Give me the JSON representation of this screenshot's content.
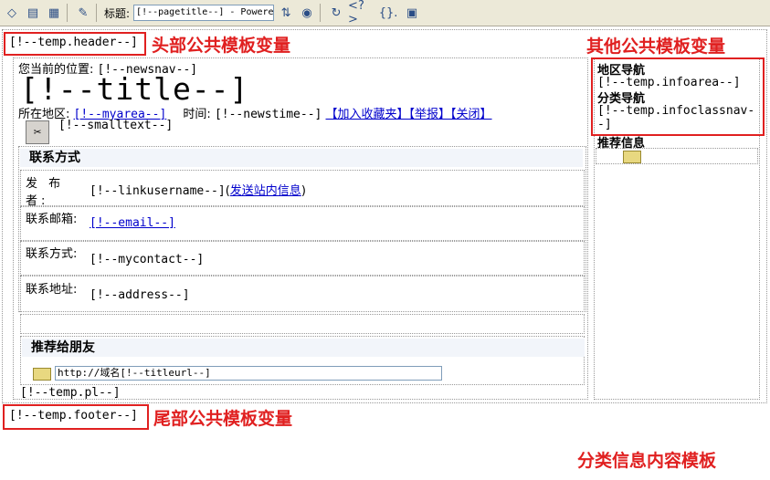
{
  "toolbar": {
    "title_label": "标题:",
    "title_value": "[!--pagetitle--] - Powere"
  },
  "labels": {
    "header_var": "头部公共模板变量",
    "other_var": "其他公共模板变量",
    "footer_var": "尾部公共模板变量",
    "content_template": "分类信息内容模板"
  },
  "template": {
    "header": "[!--temp.header--]",
    "footer": "[!--temp.footer--]",
    "pl": "[!--temp.pl--]",
    "location_label": "您当前的位置:",
    "newsnav": "[!--newsnav--]",
    "title": "[!--title--]",
    "area_label": "所在地区:",
    "myarea": "[!--myarea--]",
    "time_label": "时间:",
    "newstime": "[!--newstime--]",
    "favorite": "【加入收藏夹】",
    "report": "【举报】",
    "close": "【关闭】",
    "smalltext": "[!--smalltext--]",
    "contact_header": "联系方式",
    "publisher_label": "发 布 者:",
    "linkusername": "[!--linkusername--]",
    "send_msg_open": "(",
    "send_msg": "发送站内信息",
    "send_msg_close": ")",
    "email_label": "联系邮箱:",
    "email": "[!--email--]",
    "contact_label": "联系方式:",
    "mycontact": "[!--mycontact--]",
    "address_label": "联系地址:",
    "address": "[!--address--]",
    "recommend_header": "推荐给朋友",
    "recommend_url": "http://域名[!--titleurl--]"
  },
  "sidebar": {
    "area_nav": "地区导航",
    "infoarea": "[!--temp.infoarea--]",
    "class_nav": "分类导航",
    "infoclassnav": "[!--temp.infoclassnav--]",
    "recommend_info": "推荐信息"
  }
}
